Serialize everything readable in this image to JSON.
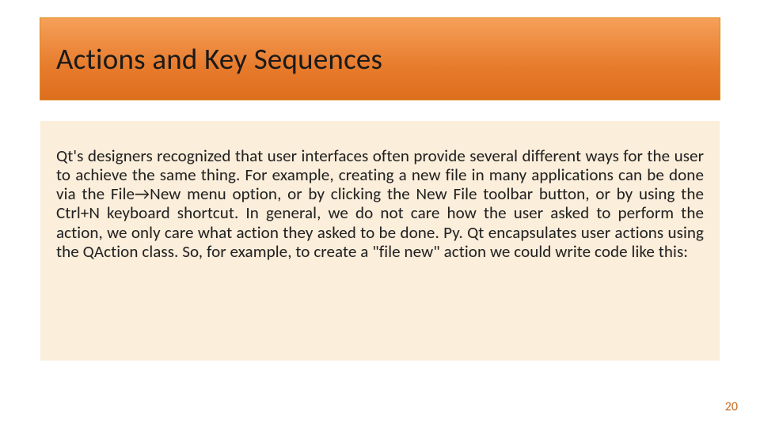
{
  "slide": {
    "title": "Actions and Key Sequences",
    "body": "Qt's designers recognized that user interfaces often provide several different ways for the user to achieve the same thing. For example, creating a new file in many applications can be done via the File→New menu option, or by clicking the New File toolbar button, or by using the Ctrl+N keyboard shortcut. In general, we do not care how the user asked to perform the action, we only care what action they asked to be done. Py. Qt encapsulates user actions using the QAction class. So, for example, to create a \"file new\" action we could write code like this:",
    "page_number": "20"
  }
}
